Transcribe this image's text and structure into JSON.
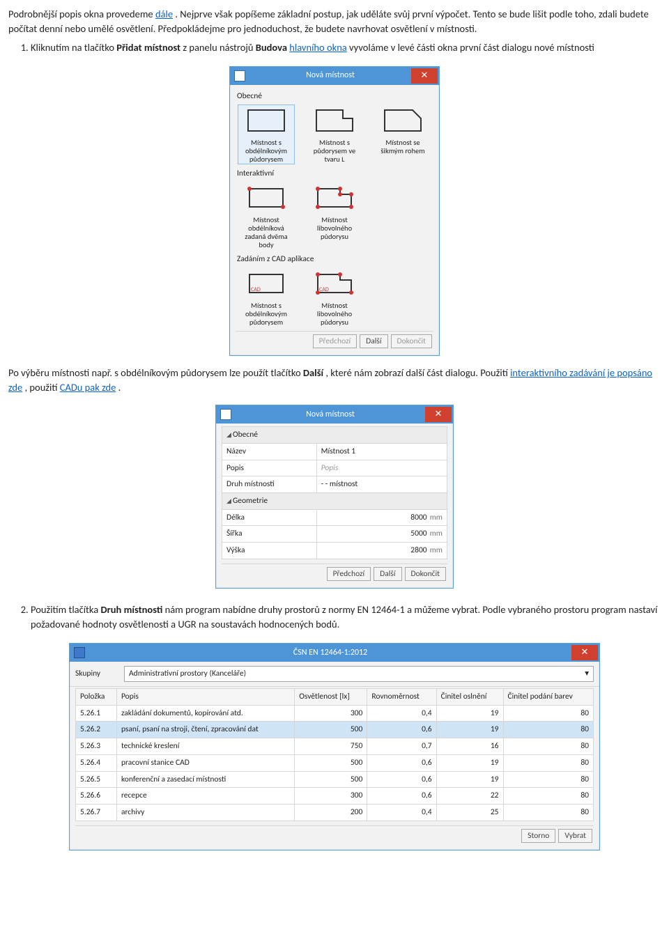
{
  "intro": {
    "p1a": "Podrobnější popis okna provedeme ",
    "p1link": "dále",
    "p1b": ". Nejprve však popíšeme základní postup, jak uděláte svůj první výpočet. Tento se bude lišit podle toho, zdali budete počítat denní nebo umělé osvětlení. Předpokládejme pro jednoduchost, že budete navrhovat osvětlení v místnosti."
  },
  "step1": {
    "pre": "Kliknutím na tlačítko ",
    "btn": "Přidat místnost",
    "mid": " z panelu nástrojů ",
    "panel": "Budova",
    "link": " hlavního okna",
    "post": " vyvoláme v levé části okna první část dialogu nové místnosti"
  },
  "dlg1": {
    "title": "Nová místnost",
    "sec_general": "Obecné",
    "sec_interactive": "Interaktivní",
    "sec_cad": "Zadáním z CAD aplikace",
    "shapes_general": [
      "Místnost s obdélníkovým půdorysem",
      "Místnost s půdorysem ve tvaru L",
      "Místnost se šikmým rohem"
    ],
    "shapes_interactive": [
      "Místnost obdélníková zadaná dvěma body",
      "Místnost libovolného půdorysu"
    ],
    "shapes_cad": [
      "Místnost s obdélníkovým půdorysem",
      "Místnost libovolného půdorysu"
    ],
    "cad_label": "CAD",
    "btn_prev": "Předchozí",
    "btn_next": "Další",
    "btn_finish": "Dokončit"
  },
  "mid_text": {
    "a": "Po výběru místnosti např. s obdélníkovým půdorysem lze použít tlačítko ",
    "btn": "Další",
    "b": ", které nám zobrazí další část dialogu. Použití ",
    "link1": "interaktivního zadávání je popsáno zde",
    "c": ", použití ",
    "link2": "CADu pak zde",
    "d": "."
  },
  "dlg2": {
    "title": "Nová místnost",
    "grp_general": "Obecné",
    "grp_geometry": "Geometrie",
    "rows": {
      "name_k": "Název",
      "name_v": "Místnost 1",
      "desc_k": "Popis",
      "desc_ph": "Popis",
      "kind_k": "Druh místnosti",
      "kind_v": "- - místnost",
      "len_k": "Délka",
      "len_v": "8000",
      "len_u": "mm",
      "wid_k": "Šířka",
      "wid_v": "5000",
      "wid_u": "mm",
      "hei_k": "Výška",
      "hei_v": "2800",
      "hei_u": "mm"
    },
    "btn_prev": "Předchozí",
    "btn_next": "Další",
    "btn_finish": "Dokončit"
  },
  "step2": {
    "pre": "Použitím tlačítka ",
    "btn": "Druh místnosti",
    "post": " nám program nabídne druhy prostorů z normy EN 12464-1 a můžeme vybrat. Podle vybraného prostoru program nastaví požadované hodnoty osvětlenosti a UGR na soustavách hodnocených bodů."
  },
  "dlg3": {
    "title": "ČSN EN 12464-1:2012",
    "group_label": "Skupiny",
    "group_value": "Administrativní prostory (Kanceláře)",
    "cols": [
      "Položka",
      "Popis",
      "Osvětlenost [lx]",
      "Rovnoměrnost",
      "Činitel oslnění",
      "Činitel podání barev"
    ],
    "rows": [
      {
        "id": "5.26.1",
        "desc": "zakládání dokumentů, kopírování atd.",
        "lx": "300",
        "rov": "0,4",
        "ugr": "19",
        "ra": "80"
      },
      {
        "id": "5.26.2",
        "desc": "psaní, psaní na stroji, čtení, zpracování dat",
        "lx": "500",
        "rov": "0,6",
        "ugr": "19",
        "ra": "80",
        "hl": true
      },
      {
        "id": "5.26.3",
        "desc": "technické kreslení",
        "lx": "750",
        "rov": "0,7",
        "ugr": "16",
        "ra": "80"
      },
      {
        "id": "5.26.4",
        "desc": "pracovní stanice CAD",
        "lx": "500",
        "rov": "0,6",
        "ugr": "19",
        "ra": "80"
      },
      {
        "id": "5.26.5",
        "desc": "konferenční a zasedací místnosti",
        "lx": "500",
        "rov": "0,6",
        "ugr": "19",
        "ra": "80"
      },
      {
        "id": "5.26.6",
        "desc": "recepce",
        "lx": "300",
        "rov": "0,6",
        "ugr": "22",
        "ra": "80"
      },
      {
        "id": "5.26.7",
        "desc": "archivy",
        "lx": "200",
        "rov": "0,4",
        "ugr": "25",
        "ra": "80"
      }
    ],
    "btn_cancel": "Storno",
    "btn_select": "Vybrat"
  }
}
